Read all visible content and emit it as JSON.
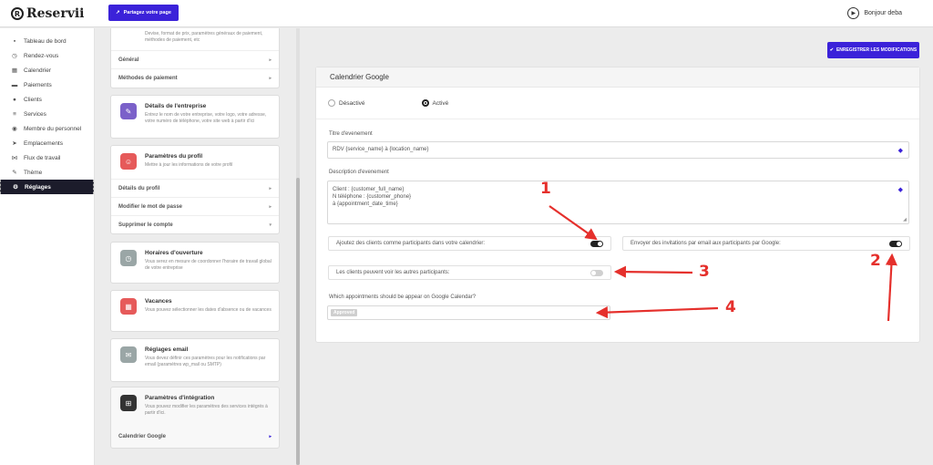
{
  "header": {
    "logo_text": "Reservii",
    "share_button": "Partagez votre page",
    "greeting": "Bonjour deba"
  },
  "sidebar": {
    "items": [
      {
        "label": "Tableau de bord",
        "icon": "dashboard-icon",
        "glyph": "▪"
      },
      {
        "label": "Rendez-vous",
        "icon": "clock-icon",
        "glyph": "◷"
      },
      {
        "label": "Calendrier",
        "icon": "calendar-icon",
        "glyph": "▦"
      },
      {
        "label": "Paiements",
        "icon": "card-icon",
        "glyph": "▬"
      },
      {
        "label": "Clients",
        "icon": "users-icon",
        "glyph": "●"
      },
      {
        "label": "Services",
        "icon": "services-icon",
        "glyph": "≡"
      },
      {
        "label": "Membre du personnel",
        "icon": "person-icon",
        "glyph": "◉"
      },
      {
        "label": "Emplacements",
        "icon": "location-icon",
        "glyph": "➤"
      },
      {
        "label": "Flux de travail",
        "icon": "workflow-icon",
        "glyph": "⋈"
      },
      {
        "label": "Thème",
        "icon": "brush-icon",
        "glyph": "✎"
      },
      {
        "label": "Réglages",
        "icon": "gear-icon",
        "glyph": "⚙"
      }
    ],
    "active_index": 10
  },
  "settings": {
    "general_card": {
      "desc": "Devise, format de prix, paramètres généraux de paiement, méthodes de paiement, etc",
      "rows": [
        "Général",
        "Méthodes de paiement"
      ]
    },
    "company_card": {
      "title": "Détails de l'entreprise",
      "desc": "Entrez le nom de votre entreprise, votre logo, votre adresse, votre numéro de téléphone, votre site web à partir d'ici",
      "color": "#7b61c9"
    },
    "profile_card": {
      "title": "Paramètres du profil",
      "desc": "Mettre à jour les informations de votre profil",
      "color": "#e65a5a",
      "rows": [
        "Détails du profil",
        "Modifier le mot de passe",
        "Supprimer le compte"
      ]
    },
    "hours_card": {
      "title": "Horaires d'ouverture",
      "desc": "Vous serez en mesure de coordonner l'horaire de travail global de votre entreprise",
      "color": "#9aa6a6"
    },
    "holidays_card": {
      "title": "Vacances",
      "desc": "Vous pouvez sélectionner les dates d'absence ou de vacances",
      "color": "#e65a5a"
    },
    "email_card": {
      "title": "Réglages email",
      "desc": "Vous devez définir ces paramètres pour les notifications par email (paramètres wp_mail ou SMTP)",
      "color": "#9aa6a6"
    },
    "integration_card": {
      "title": "Paramètres d'intégration",
      "desc": "Vous pouvez modifier les paramètres des services intégrés à partir d'ici.",
      "color": "#333333",
      "rows": [
        "Calendrier Google"
      ]
    }
  },
  "main": {
    "save_button": "ENREGISTRER LES MODIFICATIONS",
    "card_title": "Calendrier Google",
    "radio_off": "Désactivé",
    "radio_on": "Activé",
    "event_title_label": "Titre d'evenement",
    "event_title_value": "RDV {service_name} à {location_name}",
    "event_desc_label": "Description d'evenement",
    "event_desc_lines": [
      "Client : {customer_full_name}",
      "N téléphone : {customer_phone}",
      "à {appointment_date_time}"
    ],
    "toggle_add_clients": "Ajoutez des clients comme participants dans votre calendrier:",
    "toggle_send_invites": "Envoyer des invitations par email aux participants par Google:",
    "toggle_see_others": "Les clients peuvent voir les autres participants:",
    "appointments_label": "Which appointments should be appear on Google Calendar?",
    "approved_chip": "Approved"
  },
  "annotations": [
    "1",
    "2",
    "3",
    "4"
  ],
  "colors": {
    "accent": "#3b22d9",
    "annotation": "#e5302c"
  }
}
